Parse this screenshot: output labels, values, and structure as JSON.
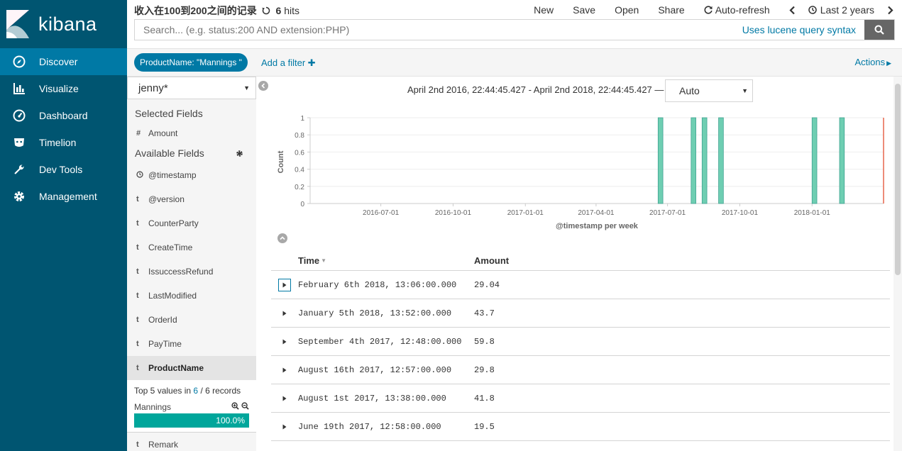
{
  "app": {
    "name": "kibana"
  },
  "nav": [
    {
      "label": "Discover",
      "icon": "compass-icon",
      "active": true
    },
    {
      "label": "Visualize",
      "icon": "bar-chart-icon"
    },
    {
      "label": "Dashboard",
      "icon": "dashboard-icon"
    },
    {
      "label": "Timelion",
      "icon": "timelion-icon"
    },
    {
      "label": "Dev Tools",
      "icon": "wrench-icon"
    },
    {
      "label": "Management",
      "icon": "gear-icon"
    }
  ],
  "header": {
    "title": "收入在100到200之间的记录",
    "hit_count": "6",
    "hits_label": "hits",
    "menu": {
      "new": "New",
      "save": "Save",
      "open": "Open",
      "share": "Share",
      "auto_refresh": "Auto-refresh",
      "time": "Last 2 years"
    }
  },
  "search": {
    "placeholder": "Search... (e.g. status:200 AND extension:PHP)",
    "lucene": "Uses lucene query syntax"
  },
  "filters": {
    "pill": "ProductName: \"Mannings \"",
    "add_filter": "Add a filter",
    "actions": "Actions"
  },
  "sidebar": {
    "index_pattern": "jenny*",
    "selected_title": "Selected Fields",
    "selected_fields": [
      {
        "type": "#",
        "name": "Amount"
      }
    ],
    "available_title": "Available Fields",
    "available_fields": [
      {
        "type": "clock",
        "name": "@timestamp"
      },
      {
        "type": "t",
        "name": "@version"
      },
      {
        "type": "t",
        "name": "CounterParty"
      },
      {
        "type": "t",
        "name": "CreateTime"
      },
      {
        "type": "t",
        "name": "IssuccessRefund"
      },
      {
        "type": "t",
        "name": "LastModified"
      },
      {
        "type": "t",
        "name": "OrderId"
      },
      {
        "type": "t",
        "name": "PayTime"
      },
      {
        "type": "t",
        "name": "ProductName"
      }
    ],
    "details": {
      "prefix": "Top 5 values in",
      "in_count": "6",
      "sep": "/",
      "total": "6 records",
      "value": "Mannings",
      "percent": "100.0%",
      "fraction": 1.0
    },
    "after_fields": [
      {
        "type": "t",
        "name": "Remark"
      }
    ]
  },
  "time_range": {
    "text": "April 2nd 2016, 22:44:45.427 - April 2nd 2018, 22:44:45.427 —",
    "interval": "Auto"
  },
  "chart_data": {
    "type": "bar",
    "title": "",
    "xlabel": "@timestamp per week",
    "ylabel": "Count",
    "yticks": [
      "0",
      "0.2",
      "0.4",
      "0.6",
      "0.8",
      "1"
    ],
    "ylim": [
      0,
      1
    ],
    "xlim": [
      "2016-04-02",
      "2018-04-02"
    ],
    "xticks": [
      "2016-07-01",
      "2016-10-01",
      "2017-01-01",
      "2017-04-01",
      "2017-07-01",
      "2017-10-01",
      "2018-01-01"
    ],
    "x": [
      "2017-06-19",
      "2017-07-31",
      "2017-08-14",
      "2017-09-04",
      "2018-01-01",
      "2018-02-05"
    ],
    "values": [
      1,
      1,
      1,
      1,
      1,
      1
    ],
    "bar_color": "#6eceb2",
    "now_line_color": "#e7664c"
  },
  "table": {
    "columns": {
      "time": "Time",
      "amount": "Amount"
    },
    "rows": [
      {
        "time": "February 6th 2018, 13:06:00.000",
        "amount": "29.04"
      },
      {
        "time": "January 5th 2018, 13:52:00.000",
        "amount": "43.7"
      },
      {
        "time": "September 4th 2017, 12:48:00.000",
        "amount": "59.8"
      },
      {
        "time": "August 16th 2017, 12:57:00.000",
        "amount": "29.8"
      },
      {
        "time": "August 1st 2017, 13:38:00.000",
        "amount": "41.8"
      },
      {
        "time": "June 19th 2017, 12:58:00.000",
        "amount": "19.5"
      }
    ]
  },
  "colors": {
    "nav_bg": "#005571",
    "nav_active": "#0079a5",
    "link": "#0079a5",
    "accent": "#00a69b"
  }
}
